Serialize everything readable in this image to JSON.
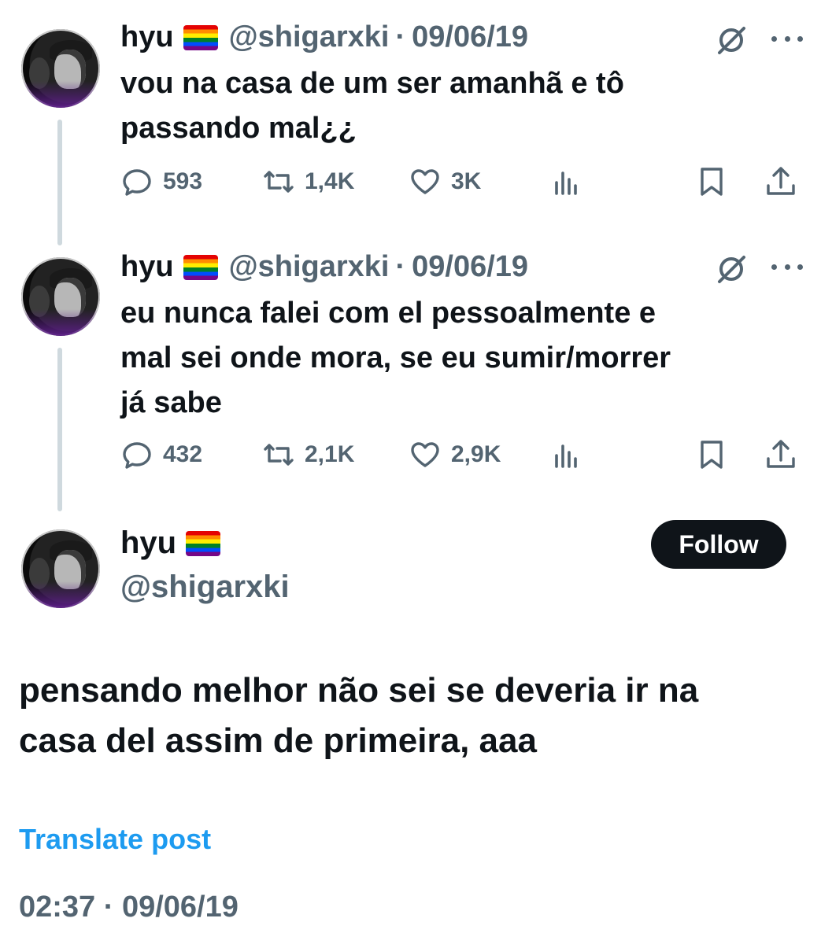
{
  "tweets": [
    {
      "name": "hyu",
      "handle": "@shigarxki",
      "separator": "·",
      "date": "09/06/19",
      "text": "vou na casa de um ser amanhã e tô\npassando mal¿¿",
      "replies": "593",
      "reposts": "1,4K",
      "likes": "3K"
    },
    {
      "name": "hyu",
      "handle": "@shigarxki",
      "separator": "·",
      "date": "09/06/19",
      "text": "eu nunca falei com el pessoalmente e\nmal sei onde mora, se eu sumir/morrer\njá sabe",
      "replies": "432",
      "reposts": "2,1K",
      "likes": "2,9K"
    }
  ],
  "main": {
    "name": "hyu",
    "handle": "@shigarxki",
    "follow_label": "Follow",
    "text": "pensando melhor não sei se deveria ir na\ncasa del assim de primeira, aaa",
    "translate_label": "Translate post",
    "timestamp": "02:37 · 09/06/19"
  },
  "icons": {
    "reply": "speech-bubble-icon",
    "repost": "repost-arrows-icon",
    "like": "heart-icon",
    "views": "bar-chart-icon",
    "bookmark": "bookmark-icon",
    "share": "share-upload-icon",
    "grok": "grok-slash-icon",
    "more": "ellipsis-icon",
    "flag": "rainbow-flag-icon"
  },
  "colors": {
    "text": "#0f1419",
    "muted": "#536471",
    "link": "#1d9bf0",
    "thread_line": "#cfd9de",
    "follow_bg": "#0f1419"
  }
}
